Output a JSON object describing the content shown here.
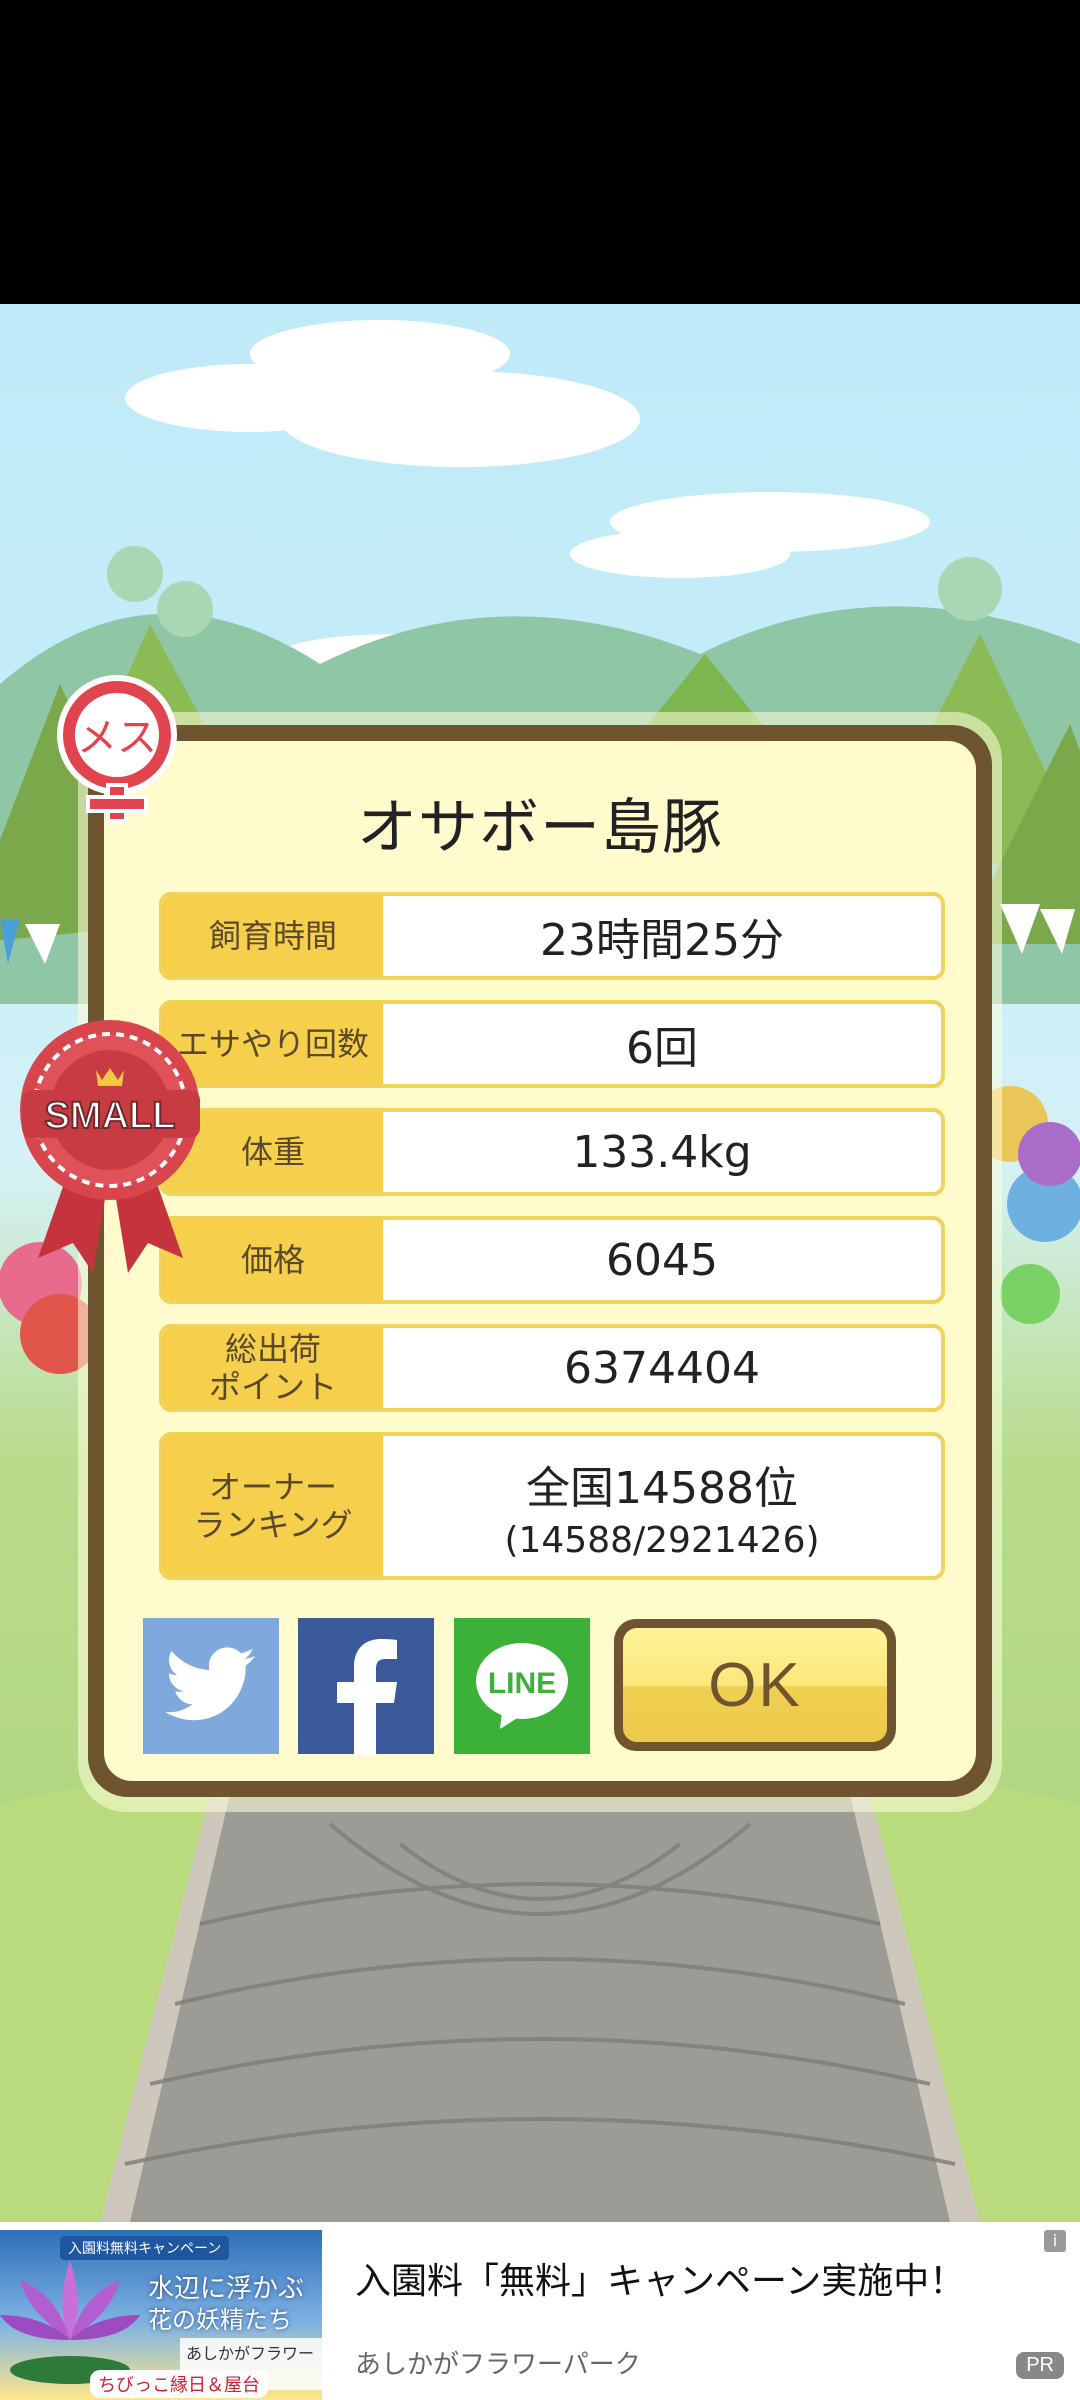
{
  "dialog": {
    "pig_name": "オサボー島豚",
    "stats": [
      {
        "label": "飼育時間",
        "value": "23時間25分"
      },
      {
        "label": "エサやり回数",
        "value": "6回"
      },
      {
        "label": "体重",
        "value": "133.4kg"
      },
      {
        "label": "価格",
        "value": "6045"
      },
      {
        "label": "総出荷\nポイント",
        "value": "6374404"
      },
      {
        "label": "オーナー\nランキング",
        "value": "全国14588位",
        "sub": "(14588/2921426)"
      }
    ],
    "ok_label": "OK",
    "share": {
      "line_label": "LINE"
    }
  },
  "badges": {
    "female_label": "メス",
    "size_label": "SMALL"
  },
  "ad": {
    "title": "入園料「無料」キャンペーン実施中！",
    "advertiser": "あしかがフラワーパーク",
    "pr_label": "PR",
    "info_label": "i",
    "image": {
      "caption": "入園料無料キャンペーン",
      "headline1": "水辺に浮かぶ",
      "headline2": "花の妖精たち",
      "park": "あしかがフラワーパーク",
      "footer": "ちびっこ縁日＆屋台"
    }
  },
  "colors": {
    "frame": "#6e5530",
    "panel": "#fffbcc",
    "label_bg": "#f6cf4c",
    "twitter": "#7fa9dc",
    "facebook": "#3a5998",
    "line": "#3cb13a"
  }
}
